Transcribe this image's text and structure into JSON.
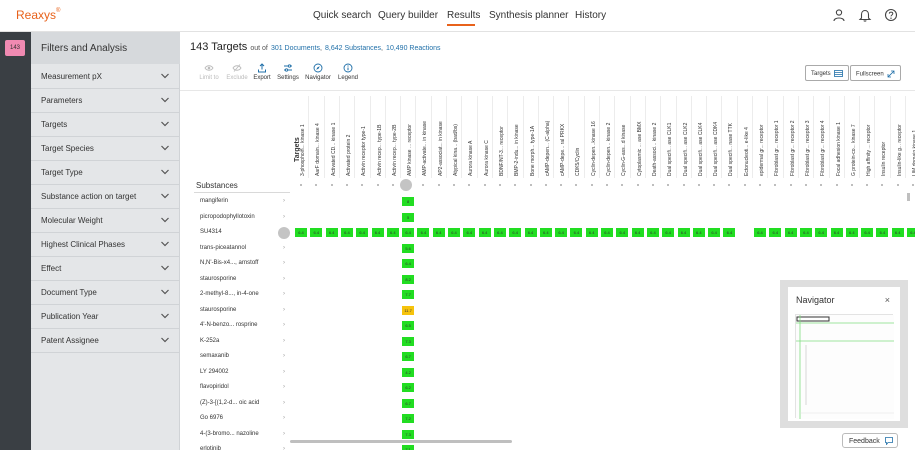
{
  "app": {
    "logo": "Reaxys",
    "logo_mark": "®"
  },
  "nav": {
    "items": [
      "Quick search",
      "Query builder",
      "Results",
      "Synthesis planner",
      "History"
    ],
    "active": "Results"
  },
  "rail": {
    "badge": "143"
  },
  "sidebar": {
    "title": "Filters and Analysis",
    "items": [
      "Measurement pX",
      "Parameters",
      "Targets",
      "Target Species",
      "Target Type",
      "Substance action on target",
      "Molecular Weight",
      "Highest Clinical Phases",
      "Effect",
      "Document Type",
      "Publication Year",
      "Patent Assignee"
    ]
  },
  "results": {
    "count_label": "143 Targets",
    "out_of": "out of",
    "documents_link": "301 Documents",
    "substances_link": "8,642 Substances",
    "reactions_link": "10,490 Reactions"
  },
  "toolbar": {
    "tools": [
      {
        "label": "Limit to",
        "icon": "eye-icon",
        "enabled": false
      },
      {
        "label": "Exclude",
        "icon": "eye-slash-icon",
        "enabled": false
      },
      {
        "label": "Export",
        "icon": "export-icon",
        "enabled": true
      },
      {
        "label": "Settings",
        "icon": "sliders-icon",
        "enabled": true
      },
      {
        "label": "Navigator",
        "icon": "compass-icon",
        "enabled": true
      },
      {
        "label": "Legend",
        "icon": "info-icon",
        "enabled": true
      }
    ],
    "targets_button": "Targets",
    "fullscreen_button": "Fullscreen"
  },
  "heatmap": {
    "targets_axis_label": "Targets",
    "substances_header": "Substances",
    "columns": [
      "3-phosphoin... kinase 1",
      "AarF domain... kinase 4",
      "Activated CD... kinase 1",
      "Activated protein 2",
      "Activin receptor type-1",
      "Activin recep... type-1B",
      "Activin recep... type-2B",
      "AMP kinase ... receptor",
      "AMP-activate... in kinase",
      "AP2-associat... in kinase",
      "Atypical kina... (bad/bs)",
      "Aurora kinase A",
      "Aurora kinase C",
      "BDNF/NT-3... receptor",
      "BMP-2-indu... in kinase",
      "Bone morph... type-1A",
      "cAMP-depen... (C-alpha)",
      "cAMP-depe... ral PRKX",
      "CDK5/Cyclin",
      "Cyclin-depen...kinase 16",
      "Cyclin-depen... kinase 2",
      "Cyclin-G-ass...d kinase",
      "Cytoplasmic ... ase BMX",
      "Death-associ... kinase 2",
      "Dual specifi... ase CLK1",
      "Dual specifi... ase CLK2",
      "Dual specifi... ase CLK4",
      "Dual specifi... ase CDK4",
      "Dual specifi... nase TTK",
      "Ectonucleoti... e-like 4",
      "epidermal gr... receptor",
      "Fibroblast gr... receptor 1",
      "Fibroblast gr... receptor 2",
      "Fibroblast gr... receptor 3",
      "Fibroblast gr... receptor 4",
      "Focal adhesion kinase 1",
      "G protein-co... kinase 7",
      "High affinity ... receptor",
      "Insulin receptor",
      "Insulin-like g... receptor",
      "LIM domain kinase 1"
    ],
    "substances": [
      {
        "name": "mangiferin",
        "value_col": 7,
        "value": "8"
      },
      {
        "name": "picropodophyllotoxin",
        "value_col": 7,
        "value": "5"
      },
      {
        "name": "SU4314",
        "value_col": 7,
        "value": "6.4",
        "row_value": "6.4"
      },
      {
        "name": "trans-piceatannol",
        "value_col": 7,
        "value": "5.6"
      },
      {
        "name": "N,N'-Bis-x4..., arnstoff",
        "value_col": 7,
        "value": "6.4"
      },
      {
        "name": "staurosporine",
        "value_col": 7,
        "value": "8.2"
      },
      {
        "name": "2-methyl-8..., in-4-one",
        "value_col": 7,
        "value": "7.7"
      },
      {
        "name": "staurosporine",
        "value_col": 7,
        "value": "11.7",
        "highlight": "yellow"
      },
      {
        "name": "4'-N-benzo... rosprine",
        "value_col": 7,
        "value": "6.5"
      },
      {
        "name": "K-252a",
        "value_col": 7,
        "value": "7.3"
      },
      {
        "name": "semaxanib",
        "value_col": 7,
        "value": "6.7"
      },
      {
        "name": "LY 294002",
        "value_col": 7,
        "value": "4.2"
      },
      {
        "name": "flavopiridol",
        "value_col": 7,
        "value": "6.2"
      },
      {
        "name": "(Z)-3-[(1,2-d... oic acid",
        "value_col": 7,
        "value": "6.7"
      },
      {
        "name": "Go 6976",
        "value_col": 7,
        "value": "7.2"
      },
      {
        "name": "4-(3-bromo... nazoline",
        "value_col": 7,
        "value": "7.3"
      },
      {
        "name": "erlotinib",
        "value_col": 7,
        "value": "7.1"
      }
    ],
    "colors": {
      "green": "#22dd22",
      "yellow": "#f6c30c"
    }
  },
  "navigator": {
    "title": "Navigator",
    "close": "×"
  },
  "feedback": {
    "label": "Feedback"
  }
}
